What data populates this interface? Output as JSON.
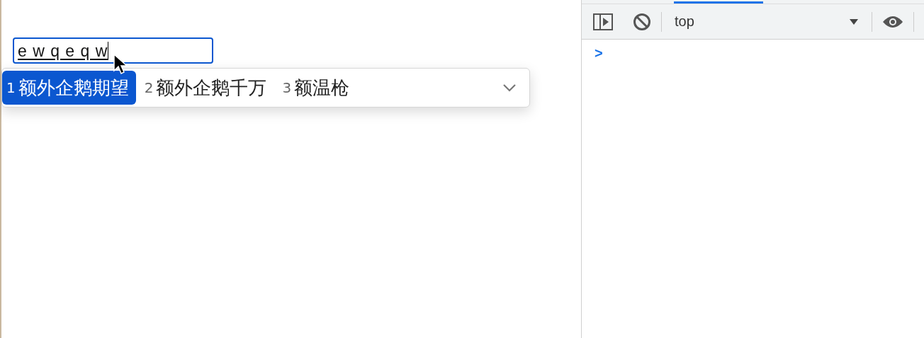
{
  "input": {
    "value": "e w q e q w"
  },
  "ime": {
    "candidates": [
      {
        "number": "1",
        "text": "额外企鹅期望",
        "selected": true
      },
      {
        "number": "2",
        "text": "额外企鹅千万",
        "selected": false
      },
      {
        "number": "3",
        "text": "额温枪",
        "selected": false
      }
    ]
  },
  "devtools": {
    "context": "top",
    "prompt": ">"
  }
}
